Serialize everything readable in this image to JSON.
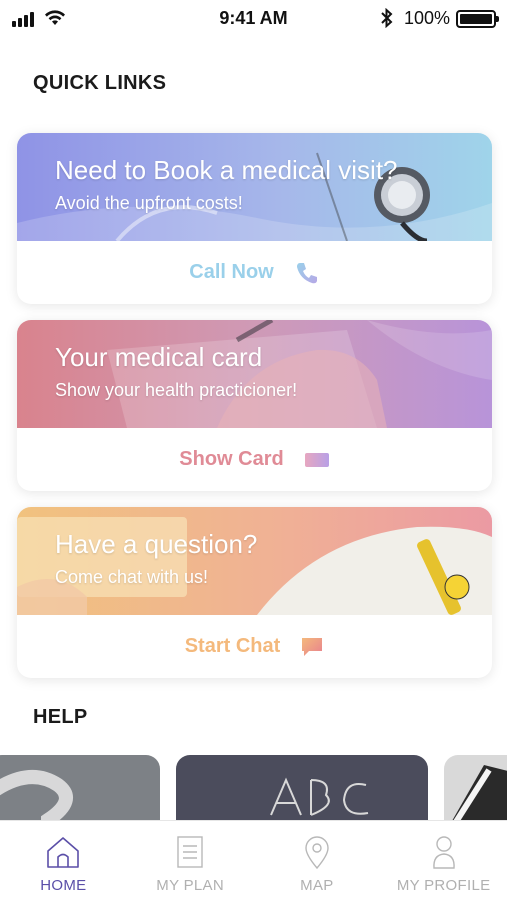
{
  "status_bar": {
    "time": "9:41 AM",
    "battery": "100%"
  },
  "quick_links": {
    "title": "QUICK LINKS",
    "cards": [
      {
        "title": "Need to Book a medical visit?",
        "subtitle": "Avoid the upfront costs!",
        "action_label": "Call Now",
        "action_icon": "phone-icon",
        "accent_color": "#9ad0ea"
      },
      {
        "title": "Your medical card",
        "subtitle": "Show your health practicioner!",
        "action_label": "Show Card",
        "action_icon": "card-icon",
        "accent_color": "#e08b96"
      },
      {
        "title": "Have a question?",
        "subtitle": "Come chat with us!",
        "action_label": "Start Chat",
        "action_icon": "chat-bubble-icon",
        "accent_color": "#f4b97c"
      }
    ]
  },
  "help": {
    "title": "HELP",
    "cards": [
      {
        "image": "question-mark-chalkboard"
      },
      {
        "image": "abc-chalkboard"
      },
      {
        "image": "open-book"
      }
    ]
  },
  "tab_bar": {
    "items": [
      {
        "label": "HOME",
        "icon": "home-icon",
        "active": true
      },
      {
        "label": "MY PLAN",
        "icon": "document-icon",
        "active": false
      },
      {
        "label": "MAP",
        "icon": "map-pin-icon",
        "active": false
      },
      {
        "label": "MY PROFILE",
        "icon": "person-icon",
        "active": false
      }
    ],
    "active_color": "#5b4fa8",
    "inactive_color": "#b0b0b0"
  }
}
